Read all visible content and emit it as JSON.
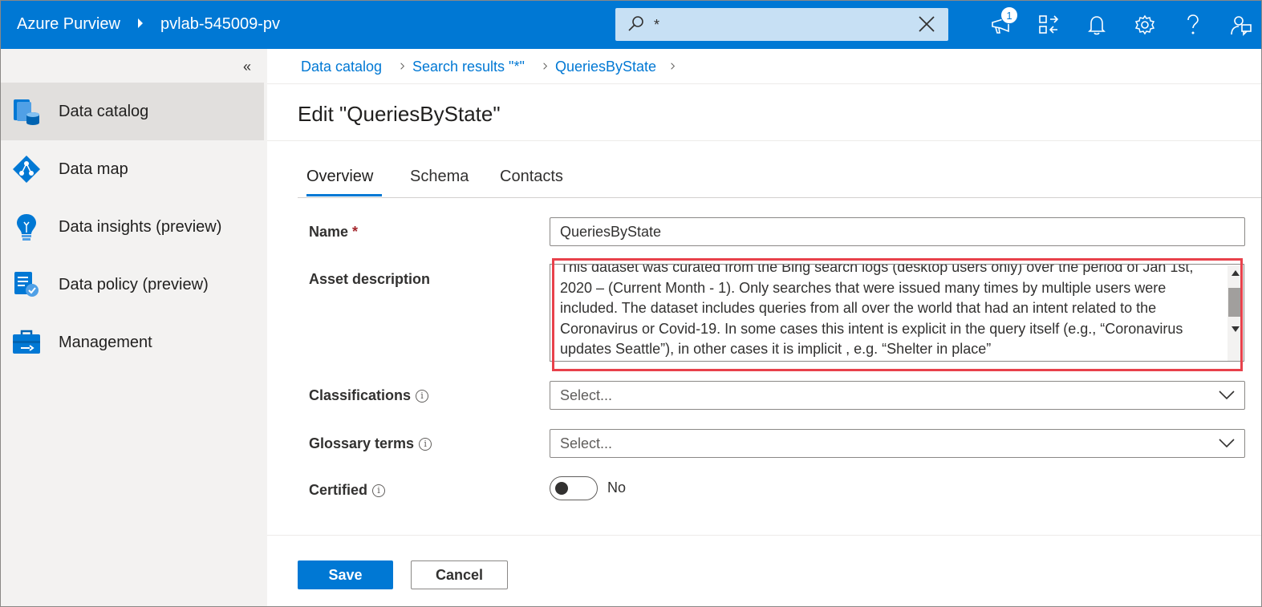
{
  "topbar": {
    "brand": "Azure Purview",
    "account": "pvlab-545009-pv",
    "search_value": "*",
    "notification_count": "1"
  },
  "sidebar": {
    "collapse_glyph": "«",
    "items": [
      {
        "label": "Data catalog",
        "icon": "data-catalog-icon",
        "active": true
      },
      {
        "label": "Data map",
        "icon": "data-map-icon",
        "active": false
      },
      {
        "label": "Data insights (preview)",
        "icon": "lightbulb-icon",
        "active": false
      },
      {
        "label": "Data policy (preview)",
        "icon": "policy-icon",
        "active": false
      },
      {
        "label": "Management",
        "icon": "toolbox-icon",
        "active": false
      }
    ]
  },
  "breadcrumb": [
    {
      "label": "Data catalog"
    },
    {
      "label": "Search results \"*\""
    },
    {
      "label": "QueriesByState"
    }
  ],
  "page_title": "Edit \"QueriesByState\"",
  "tabs": [
    {
      "label": "Overview",
      "active": true
    },
    {
      "label": "Schema",
      "active": false
    },
    {
      "label": "Contacts",
      "active": false
    }
  ],
  "form": {
    "name_label": "Name",
    "required_mark": "*",
    "name_value": "QueriesByState",
    "description_label": "Asset description",
    "description_value": "This dataset was curated from the Bing search logs (desktop users only) over the period of Jan 1st, 2020 – (Current Month - 1). Only searches that were issued many times by multiple users were included. The dataset includes queries from all over the world that had an intent related to the Coronavirus or Covid-19. In some cases this intent is explicit in the query itself (e.g., “Coronavirus updates Seattle”), in other cases it is implicit , e.g. “Shelter in place”",
    "classifications_label": "Classifications",
    "classifications_placeholder": "Select...",
    "glossary_label": "Glossary terms",
    "glossary_placeholder": "Select...",
    "certified_label": "Certified",
    "certified_value": "No",
    "info_glyph": "i"
  },
  "buttons": {
    "save": "Save",
    "cancel": "Cancel"
  },
  "colors": {
    "accent": "#0078d4",
    "highlight": "#e8414b"
  }
}
